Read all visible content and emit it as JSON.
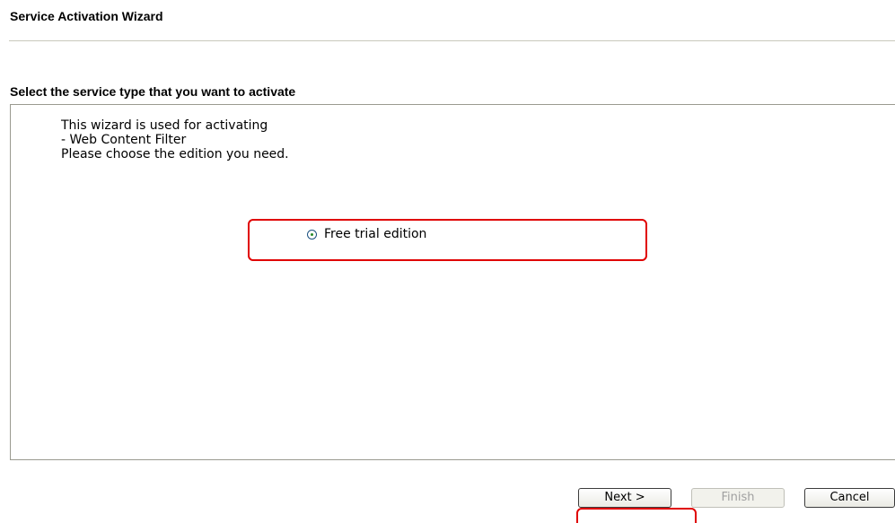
{
  "header": {
    "title": "Service Activation Wizard"
  },
  "section": {
    "title": "Select the service type that you want to activate"
  },
  "info": {
    "line1": "This wizard is used for activating",
    "line2": "- Web Content Filter",
    "line3": "Please choose the edition you need."
  },
  "options": [
    {
      "label": "Free trial edition",
      "selected": true
    }
  ],
  "buttons": {
    "next": "Next >",
    "finish": "Finish",
    "cancel": "Cancel"
  },
  "colors": {
    "highlight": "#e00000",
    "disabled_text": "#a0a0a0"
  }
}
